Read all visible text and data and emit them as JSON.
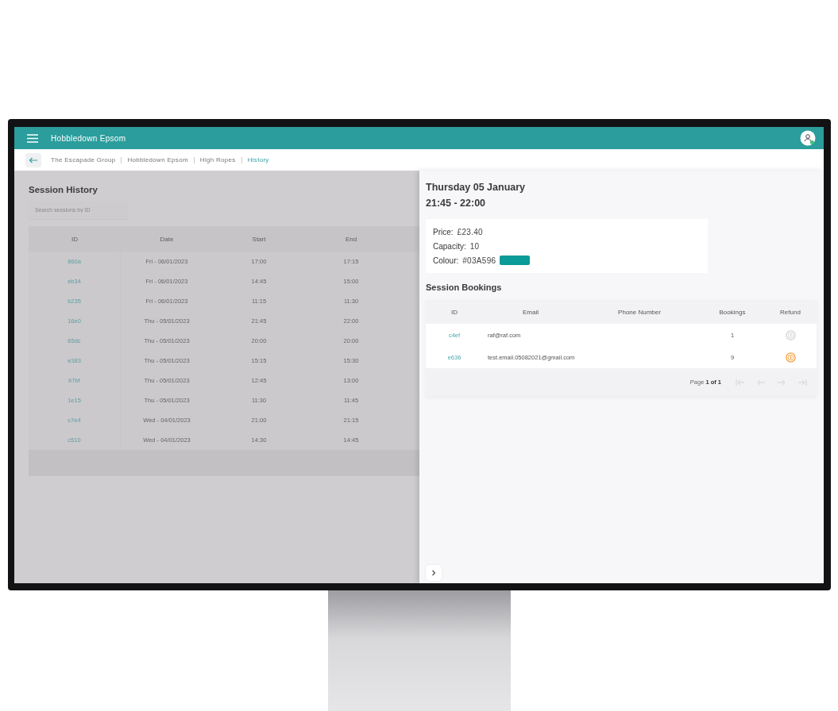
{
  "app_bar": {
    "title": "Hobbledown Epsom"
  },
  "breadcrumbs": {
    "items": [
      {
        "label": "The Escapade Group",
        "selected": false
      },
      {
        "label": "Hobbledown Epsom",
        "selected": false
      },
      {
        "label": "High Ropes",
        "selected": false
      },
      {
        "label": "History",
        "selected": true
      }
    ]
  },
  "session_history": {
    "title": "Session History",
    "search": {
      "placeholder": "Search sessions by ID"
    },
    "columns": [
      "ID",
      "Date",
      "Start",
      "End"
    ],
    "rows": [
      [
        "660a",
        "Fri - 06/01/2023",
        "17:00",
        "17:15"
      ],
      [
        "eb34",
        "Fri - 06/01/2023",
        "14:45",
        "15:00"
      ],
      [
        "b235",
        "Fri - 06/01/2023",
        "11:15",
        "11:30"
      ],
      [
        "16e0",
        "Thu - 05/01/2023",
        "21:45",
        "22:00"
      ],
      [
        "65dc",
        "Thu - 05/01/2023",
        "20:00",
        "20:00"
      ],
      [
        "e383",
        "Thu - 05/01/2023",
        "15:15",
        "15:30"
      ],
      [
        "b7bf",
        "Thu - 05/01/2023",
        "12:45",
        "13:00"
      ],
      [
        "1e15",
        "Thu - 05/01/2023",
        "11:30",
        "11:45"
      ],
      [
        "c7e4",
        "Wed - 04/01/2023",
        "21:00",
        "21:15"
      ],
      [
        "c510",
        "Wed - 04/01/2023",
        "14:30",
        "14:45"
      ]
    ]
  },
  "session_detail": {
    "date": "Thursday 05 January",
    "time": "21:45 - 22:00",
    "info": [
      {
        "label": "Price:",
        "value": "£23.40"
      },
      {
        "label": "Capacity:",
        "value": "10"
      },
      {
        "label": "Colour:",
        "value": "#03A596",
        "color": "#0a9a98"
      }
    ],
    "bookings_title": "Session Bookings",
    "columns": [
      "ID",
      "Email",
      "Phone Number",
      "Bookings",
      "Refund"
    ],
    "rows": [
      {
        "id": "c4ef",
        "email": "raf@raf.com",
        "phone": "",
        "bookings": "1",
        "refundable": false
      },
      {
        "id": "e636",
        "email": "test.email.05082021@gmail.com",
        "phone": "",
        "bookings": "9",
        "refundable": true
      }
    ],
    "pagination": {
      "label": "Page",
      "current": "1 of 1",
      "buttons": [
        {
          "kind": "first",
          "disabled": true
        },
        {
          "kind": "prev",
          "disabled": true
        },
        {
          "kind": "next",
          "disabled": true
        },
        {
          "kind": "last",
          "disabled": true
        }
      ]
    }
  }
}
